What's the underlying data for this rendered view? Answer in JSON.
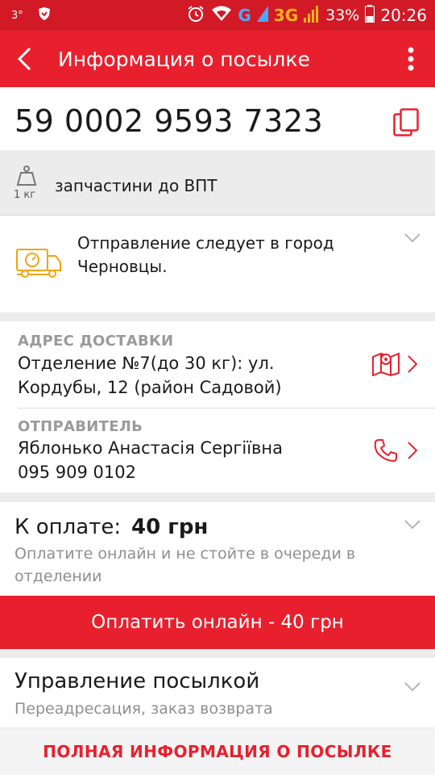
{
  "status_bar": {
    "temperature": "3°",
    "network_g": "G",
    "network_3g": "3G",
    "battery": "33%",
    "time": "20:26"
  },
  "app_bar": {
    "title": "Информация о посылке",
    "back_icon": "arrow-left-icon",
    "menu_icon": "more-vertical-icon"
  },
  "parcel": {
    "tracking_number": "59 0002 9593 7323",
    "weight": "1 кг",
    "description": "запчастини до ВПТ",
    "status_text": "Отправление следует в город Черновцы."
  },
  "delivery_address": {
    "label": "АДРЕС ДОСТАВКИ",
    "text": "Отделение №7(до 30 кг): ул. Кордубы, 12 (район Садовой)"
  },
  "sender": {
    "label": "ОТПРАВИТЕЛЬ",
    "name": "Яблонько Анастасія Сергіївна",
    "phone": "095 909 0102"
  },
  "payment": {
    "label": "К оплате:",
    "amount": "40 грн",
    "hint": "Оплатите онлайн и не стойте в очереди в отделении",
    "button_label": "Оплатить онлайн - 40 грн"
  },
  "management": {
    "title": "Управление посылкой",
    "subtitle": "Переадресация, заказ возврата"
  },
  "footer_link": "ПОЛНАЯ ИНФОРМАЦИЯ О ПОСЫЛКЕ",
  "colors": {
    "brand_red": "#e8202e",
    "status_bar_red": "#d11a26",
    "truck_orange": "#f0a313",
    "muted_text": "#8f8f8f"
  }
}
